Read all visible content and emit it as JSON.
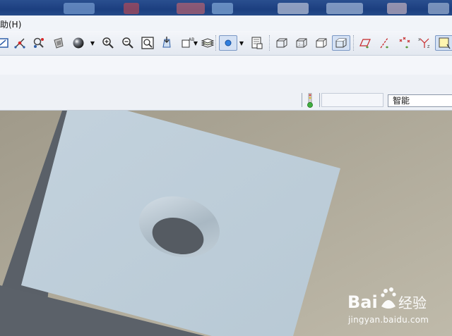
{
  "menubar": {
    "help_label": "助(H)"
  },
  "toolbar": {
    "buttons": [
      "sketch-icon",
      "datum-point-icon",
      "search-tool-icon",
      "shading-icon",
      "appearance-sphere-icon",
      "zoom-in-icon",
      "zoom-out-icon",
      "refit-icon",
      "reorient-icon",
      "named-view-icon",
      "layers-icon",
      "display-style-icon",
      "view-manager-icon",
      "wireframe-icon",
      "hidden-line-icon",
      "no-hidden-icon",
      "shaded-icon",
      "datum-plane-icon",
      "datum-axis-icon",
      "datum-point-display-icon",
      "csys-display-icon",
      "spin-center-icon"
    ]
  },
  "status": {
    "filter_value": "智能"
  },
  "watermark": {
    "brand": "Bai du 经验",
    "url": "jingyan.baidu.com"
  },
  "colors": {
    "background": "#b0ab9c",
    "part_top_face": "#bfd0dc",
    "part_side_face": "#5a6068",
    "hole_wall": "#aabac6",
    "hole_bottom": "#555b62"
  }
}
